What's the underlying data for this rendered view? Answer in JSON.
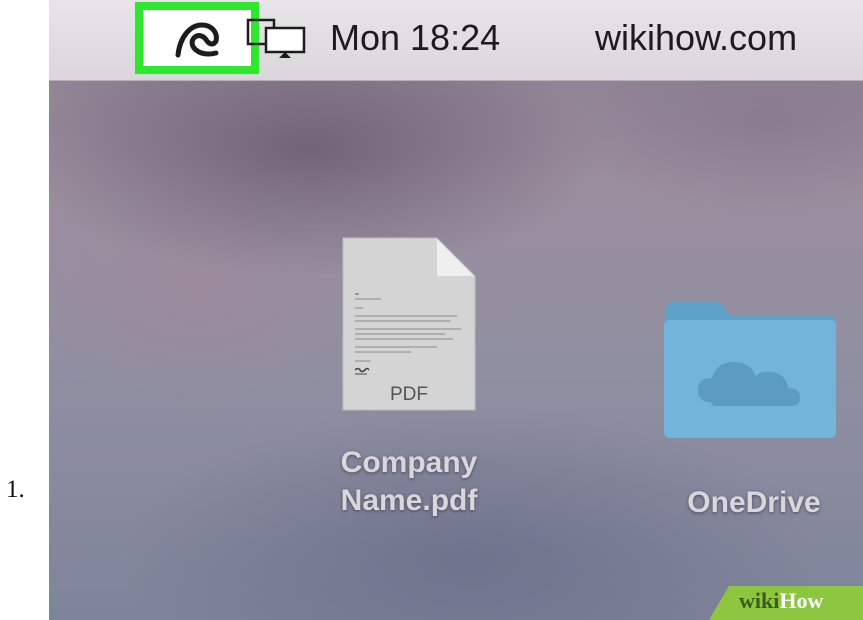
{
  "list": {
    "number": "1."
  },
  "menu_bar": {
    "highlight_color": "#2ee82e",
    "icons": [
      "avira-umbrella-icon",
      "display-mirroring-icon"
    ],
    "clock": "Mon 18:24",
    "site": "wikihow.com"
  },
  "desktop": {
    "files": [
      {
        "icon": "pdf-document-icon",
        "badge": "PDF",
        "label_line1": "Company",
        "label_line2": "Name.pdf"
      },
      {
        "icon": "onedrive-folder-icon",
        "label": "OneDrive",
        "color": "#6fb0d6"
      }
    ]
  },
  "watermark": {
    "wiki": "wiki",
    "how": "How"
  }
}
